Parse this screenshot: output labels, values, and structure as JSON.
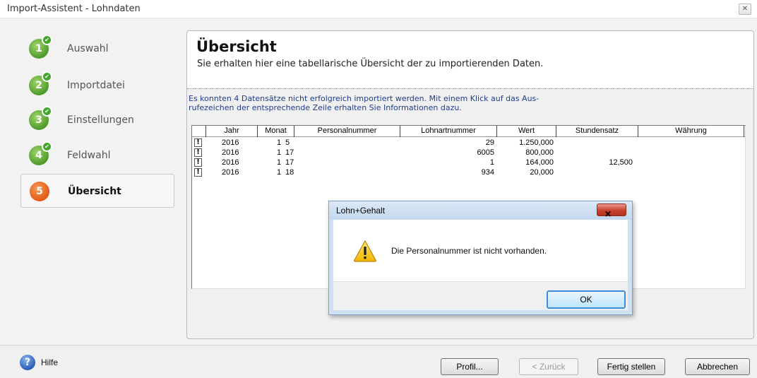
{
  "window": {
    "title": "Import-Assistent - Lohndaten",
    "close_glyph": "✕"
  },
  "steps": [
    {
      "number": "1",
      "label": "Auswahl",
      "done": true
    },
    {
      "number": "2",
      "label": "Importdatei",
      "done": true
    },
    {
      "number": "3",
      "label": "Einstellungen",
      "done": true
    },
    {
      "number": "4",
      "label": "Feldwahl",
      "done": true
    },
    {
      "number": "5",
      "label": "Übersicht",
      "done": false,
      "active": true
    }
  ],
  "panel": {
    "title": "Übersicht",
    "subtitle": "Sie erhalten hier eine tabellarische Übersicht der zu importierenden Daten.",
    "info_line1": "Es konnten 4 Datensätze nicht erfolgreich importiert werden. Mit einem Klick auf das Aus-",
    "info_line2": "rufezeichen der entsprechende Zeile erhalten Sie Informationen dazu."
  },
  "table": {
    "columns": [
      "",
      "Jahr",
      "Monat",
      "Personalnummer",
      "Lohnartnummer",
      "Wert",
      "Stundensatz",
      "Währung"
    ],
    "rows": [
      {
        "flag": "!",
        "jahr": "2016",
        "monat": "1",
        "personalnummer": "5",
        "lohnartnummer": "29",
        "wert": "1.250,000",
        "stundensatz": "",
        "waehrung": ""
      },
      {
        "flag": "!",
        "jahr": "2016",
        "monat": "1",
        "personalnummer": "17",
        "lohnartnummer": "6005",
        "wert": "800,000",
        "stundensatz": "",
        "waehrung": ""
      },
      {
        "flag": "!",
        "jahr": "2016",
        "monat": "1",
        "personalnummer": "17",
        "lohnartnummer": "1",
        "wert": "164,000",
        "stundensatz": "12,500",
        "waehrung": ""
      },
      {
        "flag": "!",
        "jahr": "2016",
        "monat": "1",
        "personalnummer": "18",
        "lohnartnummer": "934",
        "wert": "20,000",
        "stundensatz": "",
        "waehrung": ""
      }
    ]
  },
  "dialog": {
    "title": "Lohn+Gehalt",
    "close_glyph": "✕",
    "message": "Die Personalnummer ist nicht vorhanden.",
    "ok_label": "OK",
    "icon": "warning-icon"
  },
  "footer": {
    "help_glyph": "?",
    "help_label": "Hilfe",
    "profile_label": "Profil...",
    "back_label": "< Zurück",
    "finish_label": "Fertig stellen",
    "cancel_label": "Abbrechen"
  },
  "colors": {
    "step_done": "#4f9a2c",
    "step_active": "#e25a14",
    "info_text": "#1f3d8f",
    "dialog_frame": "#cfe0f2"
  }
}
